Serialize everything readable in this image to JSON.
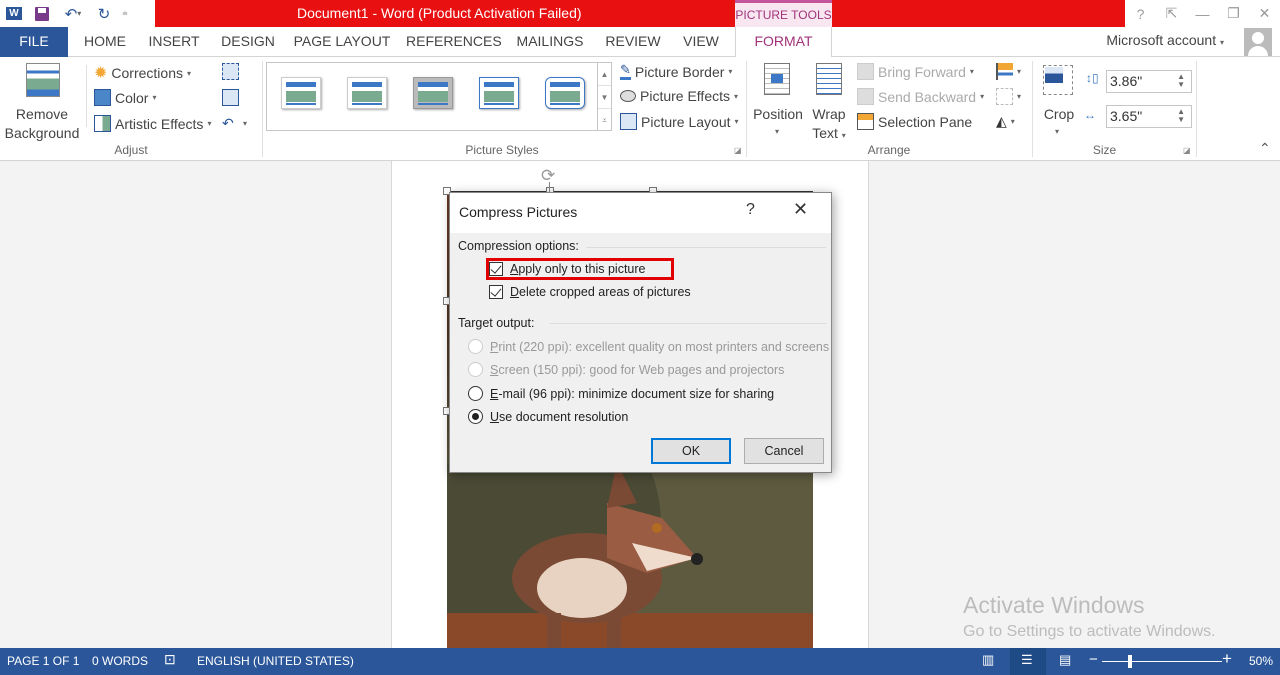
{
  "titlebar": {
    "title": "Document1 -  Word (Product Activation Failed)",
    "contextual_tab": "PICTURE TOOLS",
    "qat": [
      "word-logo-icon",
      "save-icon",
      "undo-icon",
      "redo-icon",
      "customize-qat-icon"
    ],
    "window_controls": {
      "help": "?",
      "ribbon_options": "⇱",
      "minimize": "—",
      "restore": "❐",
      "close": "✕"
    }
  },
  "tabs": [
    "FILE",
    "HOME",
    "INSERT",
    "DESIGN",
    "PAGE LAYOUT",
    "REFERENCES",
    "MAILINGS",
    "REVIEW",
    "VIEW",
    "FORMAT"
  ],
  "active_tab": "FORMAT",
  "account": {
    "label": "Microsoft account"
  },
  "ribbon": {
    "adjust": {
      "label": "Adjust",
      "remove_background": "Remove Background",
      "corrections": "Corrections",
      "color": "Color",
      "artistic_effects": "Artistic Effects"
    },
    "picture_styles": {
      "label": "Picture Styles",
      "picture_border": "Picture Border",
      "picture_effects": "Picture Effects",
      "picture_layout": "Picture Layout"
    },
    "arrange": {
      "label": "Arrange",
      "position": "Position",
      "wrap_text": "Wrap Text",
      "bring_forward": "Bring Forward",
      "send_backward": "Send Backward",
      "selection_pane": "Selection Pane"
    },
    "size": {
      "label": "Size",
      "crop": "Crop",
      "height": "3.86\"",
      "width": "3.65\""
    }
  },
  "dialog": {
    "title": "Compress Pictures",
    "help": "?",
    "close": "✕",
    "compression_options_label": "Compression options:",
    "checkboxes": [
      {
        "label_ul": "A",
        "label_rest": "pply only to this picture",
        "checked": true,
        "highlighted": true
      },
      {
        "label_ul": "D",
        "label_rest": "elete cropped areas of pictures",
        "checked": true
      }
    ],
    "target_output_label": "Target output:",
    "radios": [
      {
        "label_ul": "P",
        "label_rest": "rint (220 ppi): excellent quality on most printers and screens",
        "selected": false,
        "disabled": true
      },
      {
        "label_ul": "S",
        "label_rest": "creen (150 ppi): good for Web pages and projectors",
        "selected": false,
        "disabled": true
      },
      {
        "label_ul": "E",
        "label_rest": "-mail (96 ppi): minimize document size for sharing",
        "selected": false,
        "disabled": false
      },
      {
        "label_ul": "U",
        "label_rest": "se document resolution",
        "selected": true,
        "disabled": false
      }
    ],
    "ok": "OK",
    "cancel": "Cancel",
    "highlight_color": "#e30000"
  },
  "watermark": {
    "line1": "Activate Windows",
    "line2": "Go to Settings to activate Windows."
  },
  "statusbar": {
    "page": "PAGE 1 OF 1",
    "words": "0 WORDS",
    "language": "ENGLISH (UNITED STATES)",
    "zoom": "50%",
    "zoom_minus": "−",
    "zoom_plus": "+"
  },
  "colors": {
    "title_bar": "#e81010",
    "file_tab": "#2b579a",
    "contextual_accent": "#a1337a",
    "status_bar": "#2b579a"
  }
}
